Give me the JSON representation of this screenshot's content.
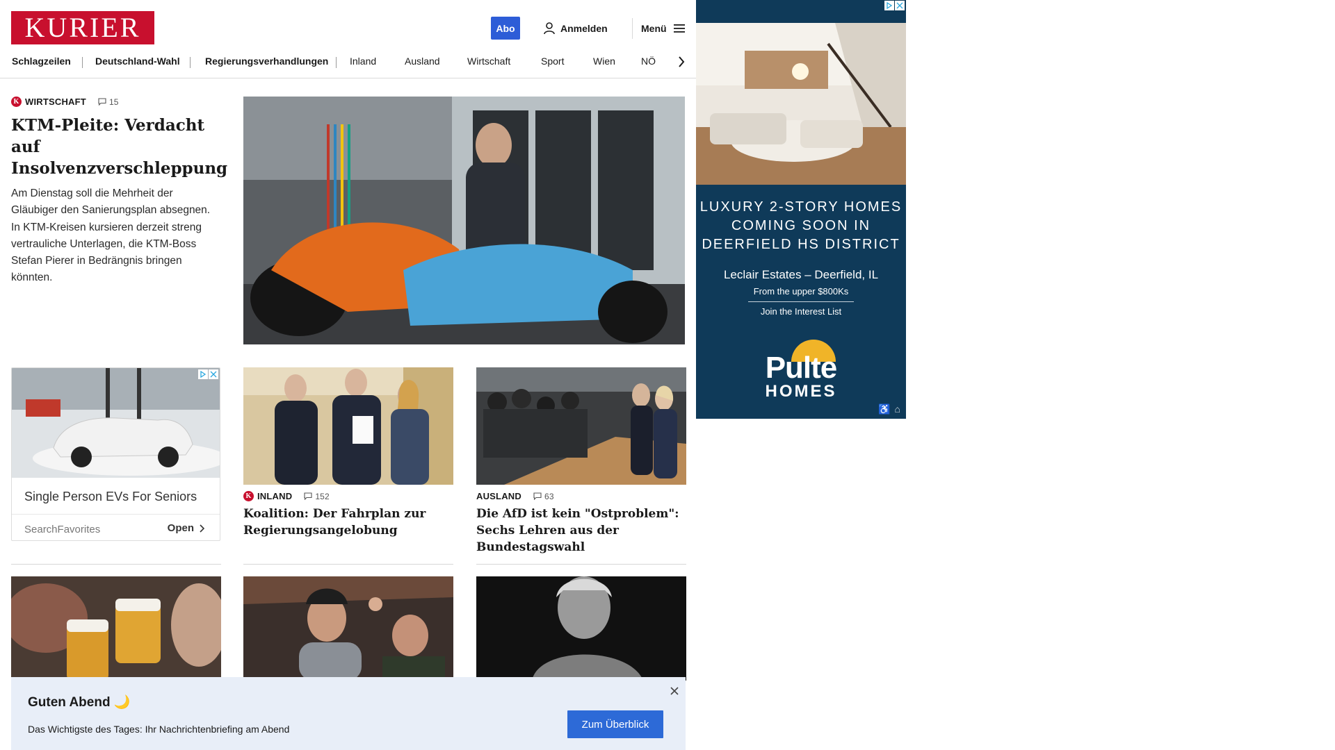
{
  "header": {
    "logo_text": "KURIER",
    "abo_label": "Abo",
    "login_label": "Anmelden",
    "menu_label": "Menü"
  },
  "nav": {
    "items": [
      "Schlagzeilen",
      "Deutschland-Wahl",
      "Regierungsverhandlungen",
      "Inland",
      "Ausland",
      "Wirtschaft",
      "Sport",
      "Wien",
      "NÖ"
    ]
  },
  "lead": {
    "section": "WIRTSCHAFT",
    "comments": "15",
    "title": "KTM-Pleite: Verdacht auf Insolvenzverschleppung",
    "teaser": "Am Dienstag soll die Mehrheit der Gläubiger den Sanierungsplan absegnen. In KTM-Kreisen kursieren derzeit streng vertrauliche Unterlagen, die KTM-Boss Stefan Pierer in Bedrängnis bringen könnten."
  },
  "ad_card": {
    "title": "Single Person EVs For Seniors",
    "source": "SearchFavorites",
    "open_label": "Open"
  },
  "cards": [
    {
      "section": "INLAND",
      "comments": "152",
      "title": "Koalition: Der Fahrplan zur Regierungsangelobung"
    },
    {
      "section": "AUSLAND",
      "comments": "63",
      "title": "Die AfD ist kein \"Ostproblem\": Sechs Lehren aus der Bundestagswahl"
    }
  ],
  "side_ad": {
    "headline_1": "LUXURY 2-STORY HOMES",
    "headline_2": "COMING SOON IN",
    "headline_3": "DEERFIELD HS DISTRICT",
    "sub": "Leclair Estates – Deerfield, IL",
    "price": "From the upper $800Ks",
    "join": "Join the Interest List",
    "brand_1": "Pulte",
    "brand_2": "HOMES"
  },
  "briefing": {
    "title": "Guten Abend 🌙",
    "subtitle": "Das Wichtigste des Tages: Ihr Nachrichtenbriefing am Abend",
    "button": "Zum Überblick"
  },
  "colors": {
    "brand_red": "#c8102e",
    "abo_blue": "#2d5dd7",
    "briefing_bg": "#e8eef8",
    "ad_navy": "#0f3a59"
  }
}
